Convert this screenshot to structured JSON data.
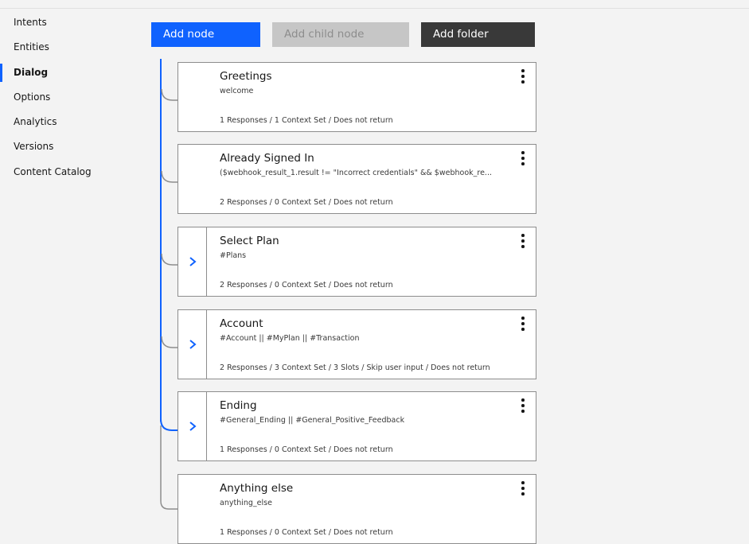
{
  "sidebar": {
    "items": [
      {
        "label": "Intents",
        "active": false
      },
      {
        "label": "Entities",
        "active": false
      },
      {
        "label": "Dialog",
        "active": true
      },
      {
        "label": "Options",
        "active": false
      },
      {
        "label": "Analytics",
        "active": false
      },
      {
        "label": "Versions",
        "active": false
      },
      {
        "label": "Content Catalog",
        "active": false
      }
    ]
  },
  "toolbar": {
    "add_node": "Add node",
    "add_child_node": "Add child node",
    "add_folder": "Add folder"
  },
  "nodes": [
    {
      "title": "Greetings",
      "condition": "welcome",
      "summary": "1 Responses / 1 Context Set / Does not return",
      "has_children": false
    },
    {
      "title": "Already Signed In",
      "condition": "($webhook_result_1.result != \"Incorrect credentials\" && $webhook_re...",
      "summary": "2 Responses / 0 Context Set / Does not return",
      "has_children": false
    },
    {
      "title": "Select Plan",
      "condition": "#Plans",
      "summary": "2 Responses / 0 Context Set / Does not return",
      "has_children": true
    },
    {
      "title": "Account",
      "condition": "#Account || #MyPlan || #Transaction",
      "summary": "2 Responses / 3 Context Set / 3 Slots / Skip user input / Does not return",
      "has_children": true
    },
    {
      "title": "Ending",
      "condition": "#General_Ending || #General_Positive_Feedback",
      "summary": "1 Responses / 0 Context Set / Does not return",
      "has_children": true
    },
    {
      "title": "Anything else",
      "condition": "anything_else",
      "summary": "1 Responses / 0 Context Set / Does not return",
      "has_children": false
    }
  ],
  "colors": {
    "accent": "#0f62fe",
    "tree_line_active": "#0f62fe",
    "tree_line": "#8d8d8d",
    "folder_button": "#393939",
    "disabled_button": "#c6c6c6"
  },
  "icons": {
    "expand": "chevron-right-icon",
    "menu": "overflow-menu-vertical-icon"
  }
}
